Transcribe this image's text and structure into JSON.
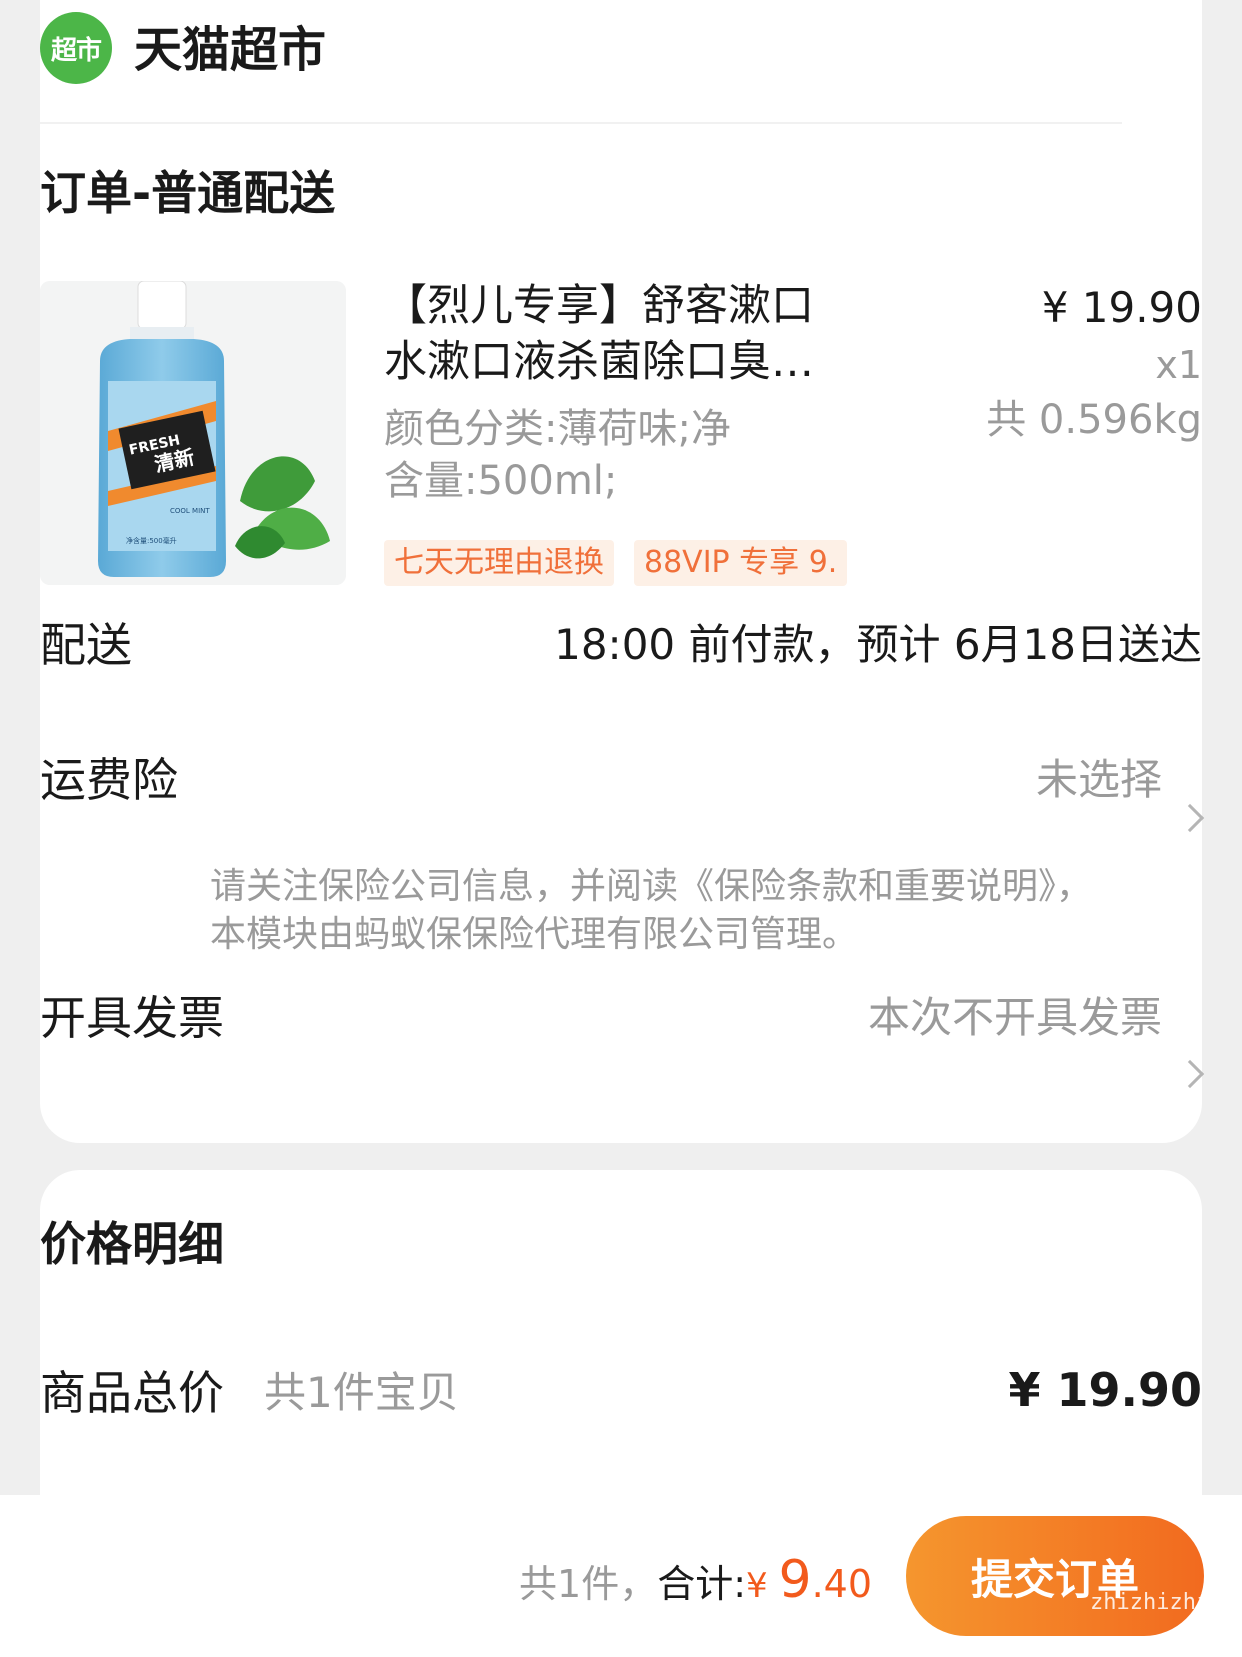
{
  "store": {
    "logo_text": "超市",
    "name": "天猫超市"
  },
  "order": {
    "title": "订单-普通配送"
  },
  "product": {
    "title_line1": "【烈儿专享】舒客漱口",
    "title_line2": "水漱口液杀菌除口臭…",
    "sku_line1": "颜色分类:薄荷味;净",
    "sku_line2": "含量:500ml;",
    "price": "¥ 19.90",
    "qty": "x1",
    "weight": "共 0.596kg",
    "tags": [
      "七天无理由退换",
      "88VIP 专享 9."
    ],
    "image": {
      "bottle_label_top": "FRESH",
      "bottle_label_main": "清新",
      "bottle_label_sub": "COOL MINT",
      "bottle_volume": "净含量:500毫升"
    }
  },
  "delivery": {
    "label": "配送",
    "value": "18:00 前付款，预计 6月18日送达"
  },
  "insurance": {
    "label": "运费险",
    "value": "未选择",
    "note": "请关注保险公司信息，并阅读《保险条款和重要说明》，本模块由蚂蚁保保险代理有限公司管理。"
  },
  "invoice": {
    "label": "开具发票",
    "value": "本次不开具发票"
  },
  "price_detail": {
    "title": "价格明细",
    "goods_total_label": "商品总价",
    "goods_total_sub": "共1件宝贝",
    "goods_total_value": "¥ 19.90"
  },
  "footer": {
    "count_text": "共1件，",
    "total_label": "合计:",
    "currency": "¥ ",
    "amount_int": "9",
    "amount_dec": ".40",
    "submit_label": "提交订单",
    "watermark": "zhizhizhi.com"
  },
  "colors": {
    "accent": "#f26a1f",
    "store_green": "#4cb648",
    "tag_text": "#f0703a",
    "tag_bg": "#fdf0e6",
    "muted": "#9a9a9a"
  }
}
